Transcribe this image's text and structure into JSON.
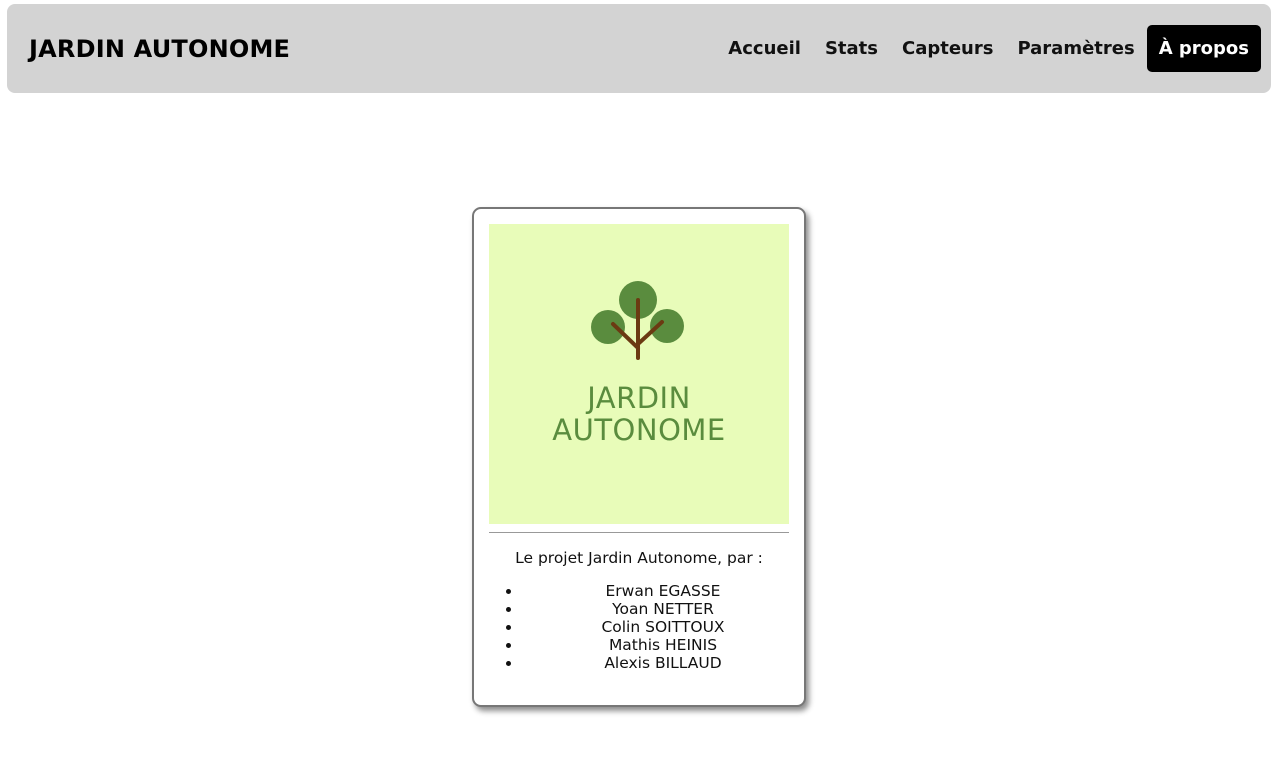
{
  "header": {
    "brand": "JARDIN AUTONOME",
    "nav": [
      {
        "label": "Accueil"
      },
      {
        "label": "Stats"
      },
      {
        "label": "Capteurs"
      },
      {
        "label": "Paramètres"
      },
      {
        "label": "À propos",
        "active": true
      }
    ]
  },
  "card": {
    "logo": {
      "icon": "tree-icon",
      "line1": "JARDIN",
      "line2": "AUTONOME"
    },
    "intro": "Le projet Jardin Autonome, par :",
    "members": [
      "Erwan EGASSE",
      "Yoan NETTER",
      "Colin SOITTOUX",
      "Mathis HEINIS",
      "Alexis BILLAUD"
    ]
  },
  "colors": {
    "navbar_bg": "#d3d3d3",
    "active_bg": "#000000",
    "logo_bg": "#e8fcb9",
    "logo_green": "#5a8c3e",
    "trunk_brown": "#6b3a12"
  }
}
